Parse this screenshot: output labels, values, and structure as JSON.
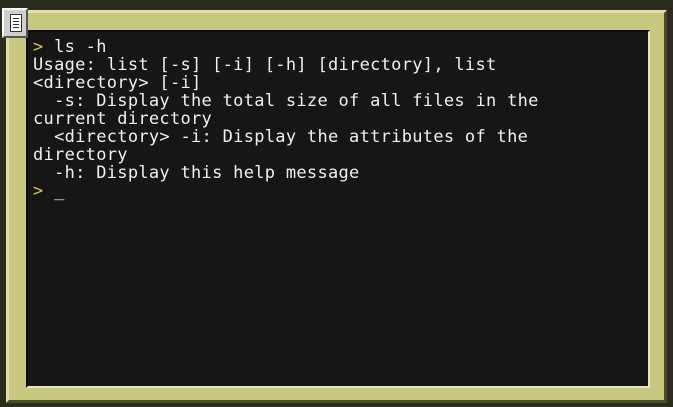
{
  "terminal": {
    "lines": [
      {
        "prompt": ">",
        "text": " ls -h"
      },
      {
        "prompt": "",
        "text": "Usage: list [-s] [-i] [-h] [directory], list"
      },
      {
        "prompt": "",
        "text": "<directory> [-i]"
      },
      {
        "prompt": "",
        "text": "  -s: Display the total size of all files in the"
      },
      {
        "prompt": "",
        "text": "current directory"
      },
      {
        "prompt": "",
        "text": "  <directory> -i: Display the attributes of the"
      },
      {
        "prompt": "",
        "text": "directory"
      },
      {
        "prompt": "",
        "text": "  -h: Display this help message"
      }
    ],
    "input_prompt": ">",
    "cursor": " _"
  },
  "colors": {
    "screen_bg": "#161616",
    "frame": "#c8c880",
    "text": "#f0f0f0",
    "prompt": "#e0c050"
  },
  "icons": {
    "corner": "document-icon"
  }
}
